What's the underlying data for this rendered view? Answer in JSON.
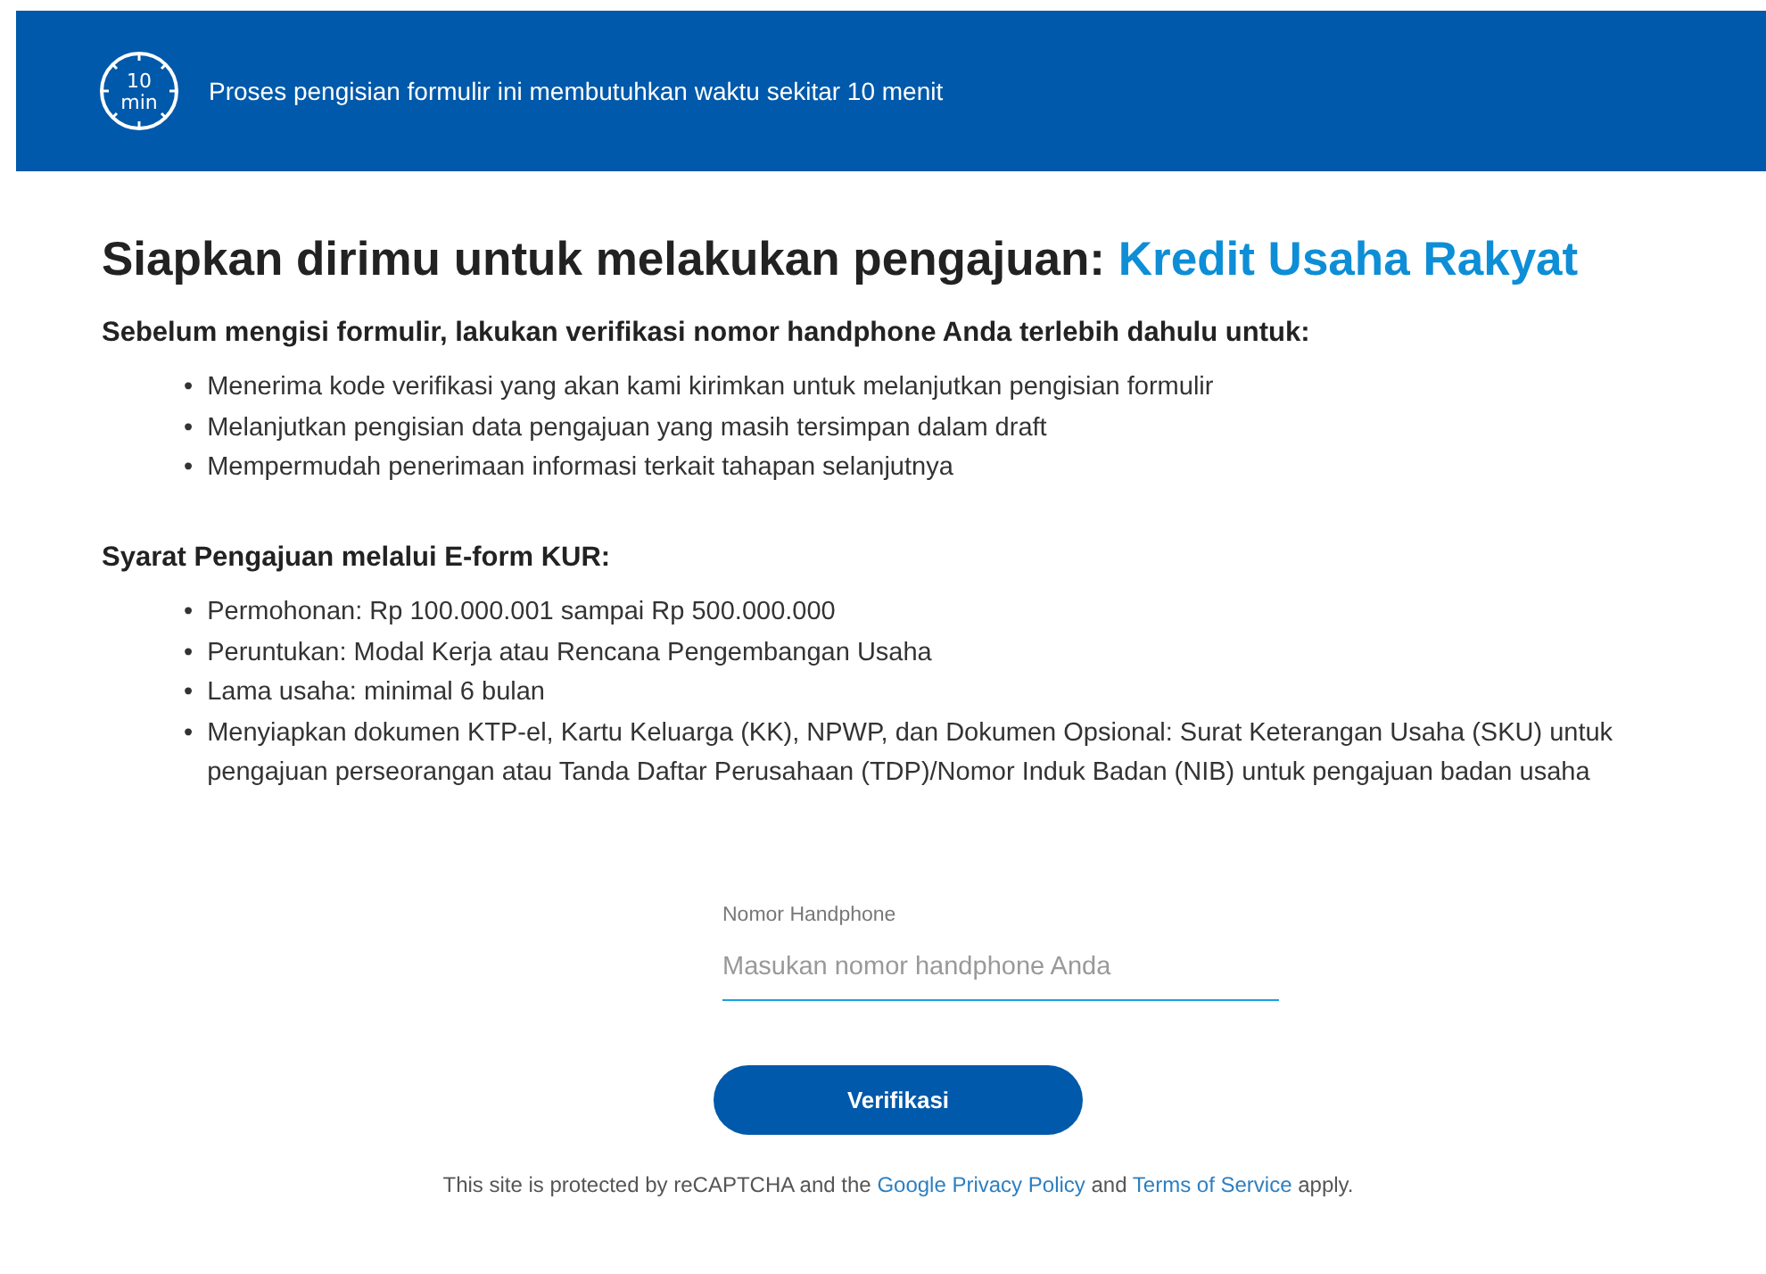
{
  "banner": {
    "icon_text": [
      "10",
      "min"
    ],
    "text": "Proses pengisian formulir ini membutuhkan waktu sekitar 10 menit"
  },
  "heading": {
    "text": "Siapkan dirimu untuk melakukan pengajuan:",
    "highlight": "Kredit Usaha Rakyat"
  },
  "bullet": "•",
  "sections": [
    {
      "title": "Sebelum mengisi formulir, lakukan verifikasi nomor handphone Anda terlebih dahulu untuk:",
      "items": [
        "Menerima kode verifikasi yang akan kami kirimkan untuk melanjutkan pengisian formulir",
        "Melanjutkan pengisian data pengajuan yang masih tersimpan dalam draft",
        "Mempermudah penerimaan informasi terkait tahapan selanjutnya"
      ]
    },
    {
      "title": "Syarat Pengajuan melalui E-form KUR:",
      "items": [
        "Permohonan: Rp 100.000.001 sampai Rp 500.000.000",
        "Peruntukan: Modal Kerja atau Rencana Pengembangan Usaha",
        "Lama usaha: minimal 6 bulan",
        "Menyiapkan dokumen KTP-el, Kartu Keluarga (KK), NPWP, dan Dokumen Opsional: Surat Keterangan Usaha (SKU) untuk pengajuan perseorangan atau Tanda Daftar Perusahaan (TDP)/Nomor Induk Badan (NIB) untuk pengajuan badan usaha"
      ]
    }
  ],
  "phone_field": {
    "label": "Nomor Handphone",
    "placeholder": "Masukan nomor handphone Anda"
  },
  "verify_button": "Verifikasi",
  "footer": [
    {
      "kind": "text",
      "text": "This site is protected by reCAPTCHA and the"
    },
    {
      "kind": "link",
      "text": "Google Privacy Policy"
    },
    {
      "kind": "text",
      "text": "and"
    },
    {
      "kind": "link",
      "text": "Terms of Service"
    },
    {
      "kind": "text",
      "text": "apply."
    }
  ]
}
